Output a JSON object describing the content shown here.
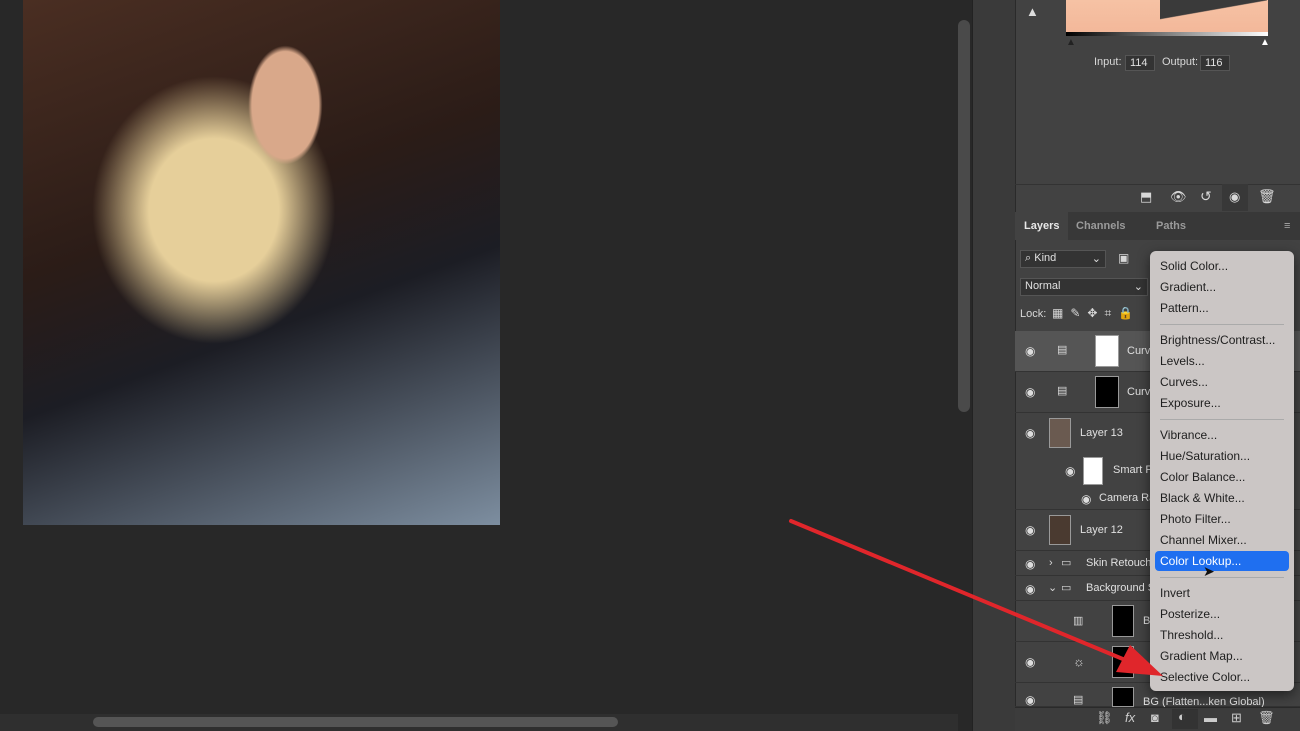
{
  "properties": {
    "input_label": "Input:",
    "input_value": "114",
    "output_label": "Output:",
    "output_value": "116"
  },
  "layers_panel": {
    "tabs": [
      {
        "label": "Layers",
        "active": true
      },
      {
        "label": "Channels"
      },
      {
        "label": "Paths"
      }
    ],
    "filter_kind": "Kind",
    "blend_mode": "Normal",
    "lock_label": "Lock:",
    "layers": [
      {
        "name": "Curv",
        "type": "curves",
        "selected": true
      },
      {
        "name": "Curv",
        "type": "curves"
      },
      {
        "name": "Layer 13",
        "type": "smart-object"
      },
      {
        "name": "Smart F",
        "type": "smart-filter"
      },
      {
        "name": "Camera Ra",
        "type": "filter"
      },
      {
        "name": "Layer 12",
        "type": "pixel"
      },
      {
        "name": "Skin Retouch",
        "type": "group",
        "expanded": false
      },
      {
        "name": "Background S",
        "type": "group",
        "expanded": true
      },
      {
        "name": "B",
        "type": "gradient-map"
      },
      {
        "name": "",
        "type": "brightness"
      },
      {
        "name": "BG (Flatten...ken Global)",
        "type": "curves"
      }
    ]
  },
  "adjustment_menu": {
    "items": [
      "Solid Color...",
      "Gradient...",
      "Pattern...",
      "Brightness/Contrast...",
      "Levels...",
      "Curves...",
      "Exposure...",
      "Vibrance...",
      "Hue/Saturation...",
      "Color Balance...",
      "Black & White...",
      "Photo Filter...",
      "Channel Mixer...",
      "Color Lookup...",
      "Invert",
      "Posterize...",
      "Threshold...",
      "Gradient Map...",
      "Selective Color..."
    ],
    "highlighted": "Color Lookup..."
  },
  "colors": {
    "highlight": "#1f6ff0",
    "arrow": "#e0262b"
  }
}
